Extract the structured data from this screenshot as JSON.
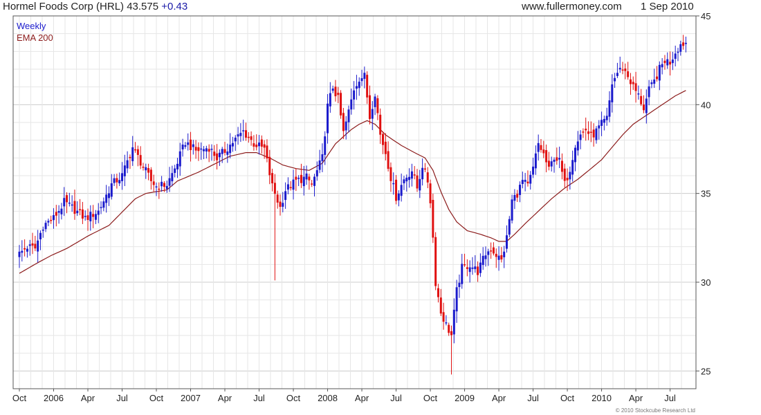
{
  "header": {
    "title": "Hormel Foods Corp (HRL) 43.575",
    "change": "+0.43",
    "site": "www.fullermoney.com",
    "date": "1 Sep 2010"
  },
  "footer": {
    "copyright": "© 2010 Stockcube Research Ltd"
  },
  "colors": {
    "up": "#1a1acc",
    "down": "#e01010",
    "ema": "#8b1a1a",
    "grid": "#e6e6e6",
    "grid_major": "#cccccc"
  },
  "chart_data": {
    "type": "candlestick",
    "period": "Weekly",
    "legend": [
      "Weekly",
      "EMA 200"
    ],
    "ylim": [
      24,
      45
    ],
    "yticks": [
      25,
      30,
      35,
      40,
      45
    ],
    "x_tick_labels": [
      "Oct",
      "2006",
      "Apr",
      "Jul",
      "Oct",
      "2007",
      "Apr",
      "Jul",
      "Oct",
      "2008",
      "Apr",
      "Jul",
      "Oct",
      "2009",
      "Apr",
      "Jul",
      "Oct",
      "2010",
      "Apr",
      "Jul"
    ],
    "x_tick_weeks": [
      0,
      13,
      26,
      39,
      52,
      65,
      78,
      91,
      104,
      117,
      130,
      143,
      156,
      169,
      182,
      195,
      208,
      221,
      234,
      247
    ],
    "close_anchors": [
      [
        0,
        31.6
      ],
      [
        3,
        32.0
      ],
      [
        6,
        31.9
      ],
      [
        9,
        33.2
      ],
      [
        13,
        33.6
      ],
      [
        17,
        34.5
      ],
      [
        20,
        34.2
      ],
      [
        25,
        33.6
      ],
      [
        30,
        34.0
      ],
      [
        35,
        35.5
      ],
      [
        39,
        36.0
      ],
      [
        43,
        37.6
      ],
      [
        47,
        36.5
      ],
      [
        50,
        35.7
      ],
      [
        52,
        35.4
      ],
      [
        56,
        35.5
      ],
      [
        59,
        36.4
      ],
      [
        63,
        37.9
      ],
      [
        67,
        37.4
      ],
      [
        72,
        37.6
      ],
      [
        75,
        37.0
      ],
      [
        78,
        37.4
      ],
      [
        81,
        37.9
      ],
      [
        85,
        38.5
      ],
      [
        89,
        37.8
      ],
      [
        93,
        37.5
      ],
      [
        96,
        35.4
      ],
      [
        99,
        34.2
      ],
      [
        101,
        35.2
      ],
      [
        105,
        35.7
      ],
      [
        109,
        35.9
      ],
      [
        111,
        35.5
      ],
      [
        115,
        37.0
      ],
      [
        117,
        39.9
      ],
      [
        119,
        41.0
      ],
      [
        121,
        40.3
      ],
      [
        123,
        38.4
      ],
      [
        125,
        39.6
      ],
      [
        127,
        40.9
      ],
      [
        129,
        41.5
      ],
      [
        131,
        41.6
      ],
      [
        133,
        39.3
      ],
      [
        135,
        40.7
      ],
      [
        137,
        38.3
      ],
      [
        139,
        37.3
      ],
      [
        141,
        35.9
      ],
      [
        143,
        34.8
      ],
      [
        146,
        35.8
      ],
      [
        149,
        36.3
      ],
      [
        151,
        35.3
      ],
      [
        153,
        36.6
      ],
      [
        155,
        35.7
      ],
      [
        156,
        34.6
      ],
      [
        157,
        32.5
      ],
      [
        158,
        30.0
      ],
      [
        160,
        28.3
      ],
      [
        162,
        27.6
      ],
      [
        164,
        27.0
      ],
      [
        166,
        29.5
      ],
      [
        168,
        30.8
      ],
      [
        171,
        31.0
      ],
      [
        174,
        30.6
      ],
      [
        177,
        31.6
      ],
      [
        179,
        31.9
      ],
      [
        183,
        31.2
      ],
      [
        185,
        32.5
      ],
      [
        187,
        34.6
      ],
      [
        189,
        35.0
      ],
      [
        191,
        35.7
      ],
      [
        193,
        35.4
      ],
      [
        195,
        36.4
      ],
      [
        197,
        37.8
      ],
      [
        199,
        37.2
      ],
      [
        201,
        36.3
      ],
      [
        203,
        37.1
      ],
      [
        205,
        36.8
      ],
      [
        207,
        35.5
      ],
      [
        209,
        36.4
      ],
      [
        211,
        37.8
      ],
      [
        213,
        38.3
      ],
      [
        215,
        38.6
      ],
      [
        217,
        38.2
      ],
      [
        219,
        38.5
      ],
      [
        221,
        38.9
      ],
      [
        223,
        39.2
      ],
      [
        225,
        41.2
      ],
      [
        227,
        41.8
      ],
      [
        229,
        42.1
      ],
      [
        231,
        41.6
      ],
      [
        233,
        41.0
      ],
      [
        235,
        40.5
      ],
      [
        237,
        39.8
      ],
      [
        239,
        40.8
      ],
      [
        241,
        41.3
      ],
      [
        243,
        42.0
      ],
      [
        245,
        42.5
      ],
      [
        247,
        42.4
      ],
      [
        249,
        43.0
      ],
      [
        251,
        43.4
      ],
      [
        253,
        43.5
      ]
    ],
    "ema_anchors": [
      [
        0,
        30.5
      ],
      [
        7,
        31.1
      ],
      [
        12,
        31.5
      ],
      [
        18,
        31.9
      ],
      [
        26,
        32.6
      ],
      [
        34,
        33.2
      ],
      [
        40,
        34.1
      ],
      [
        44,
        34.7
      ],
      [
        48,
        35.0
      ],
      [
        52,
        35.1
      ],
      [
        56,
        35.2
      ],
      [
        60,
        35.7
      ],
      [
        68,
        36.2
      ],
      [
        76,
        36.8
      ],
      [
        80,
        37.1
      ],
      [
        86,
        37.3
      ],
      [
        90,
        37.3
      ],
      [
        95,
        37.0
      ],
      [
        100,
        36.6
      ],
      [
        105,
        36.4
      ],
      [
        110,
        36.3
      ],
      [
        115,
        36.7
      ],
      [
        120,
        37.8
      ],
      [
        126,
        38.6
      ],
      [
        129,
        38.9
      ],
      [
        132,
        39.1
      ],
      [
        135,
        38.9
      ],
      [
        139,
        38.3
      ],
      [
        145,
        37.7
      ],
      [
        150,
        37.3
      ],
      [
        154,
        37.0
      ],
      [
        157,
        36.3
      ],
      [
        160,
        35.1
      ],
      [
        163,
        34.1
      ],
      [
        166,
        33.4
      ],
      [
        170,
        32.9
      ],
      [
        175,
        32.7
      ],
      [
        179,
        32.5
      ],
      [
        182,
        32.3
      ],
      [
        185,
        32.3
      ],
      [
        188,
        32.7
      ],
      [
        192,
        33.3
      ],
      [
        197,
        34.0
      ],
      [
        202,
        34.7
      ],
      [
        207,
        35.3
      ],
      [
        212,
        35.8
      ],
      [
        217,
        36.4
      ],
      [
        221,
        36.9
      ],
      [
        225,
        37.6
      ],
      [
        229,
        38.3
      ],
      [
        233,
        38.9
      ],
      [
        237,
        39.3
      ],
      [
        241,
        39.7
      ],
      [
        245,
        40.1
      ],
      [
        249,
        40.5
      ],
      [
        253,
        40.8
      ]
    ],
    "spikes": [
      {
        "week": 97,
        "low": 30.1
      },
      {
        "week": 164,
        "low": 24.8
      }
    ]
  }
}
